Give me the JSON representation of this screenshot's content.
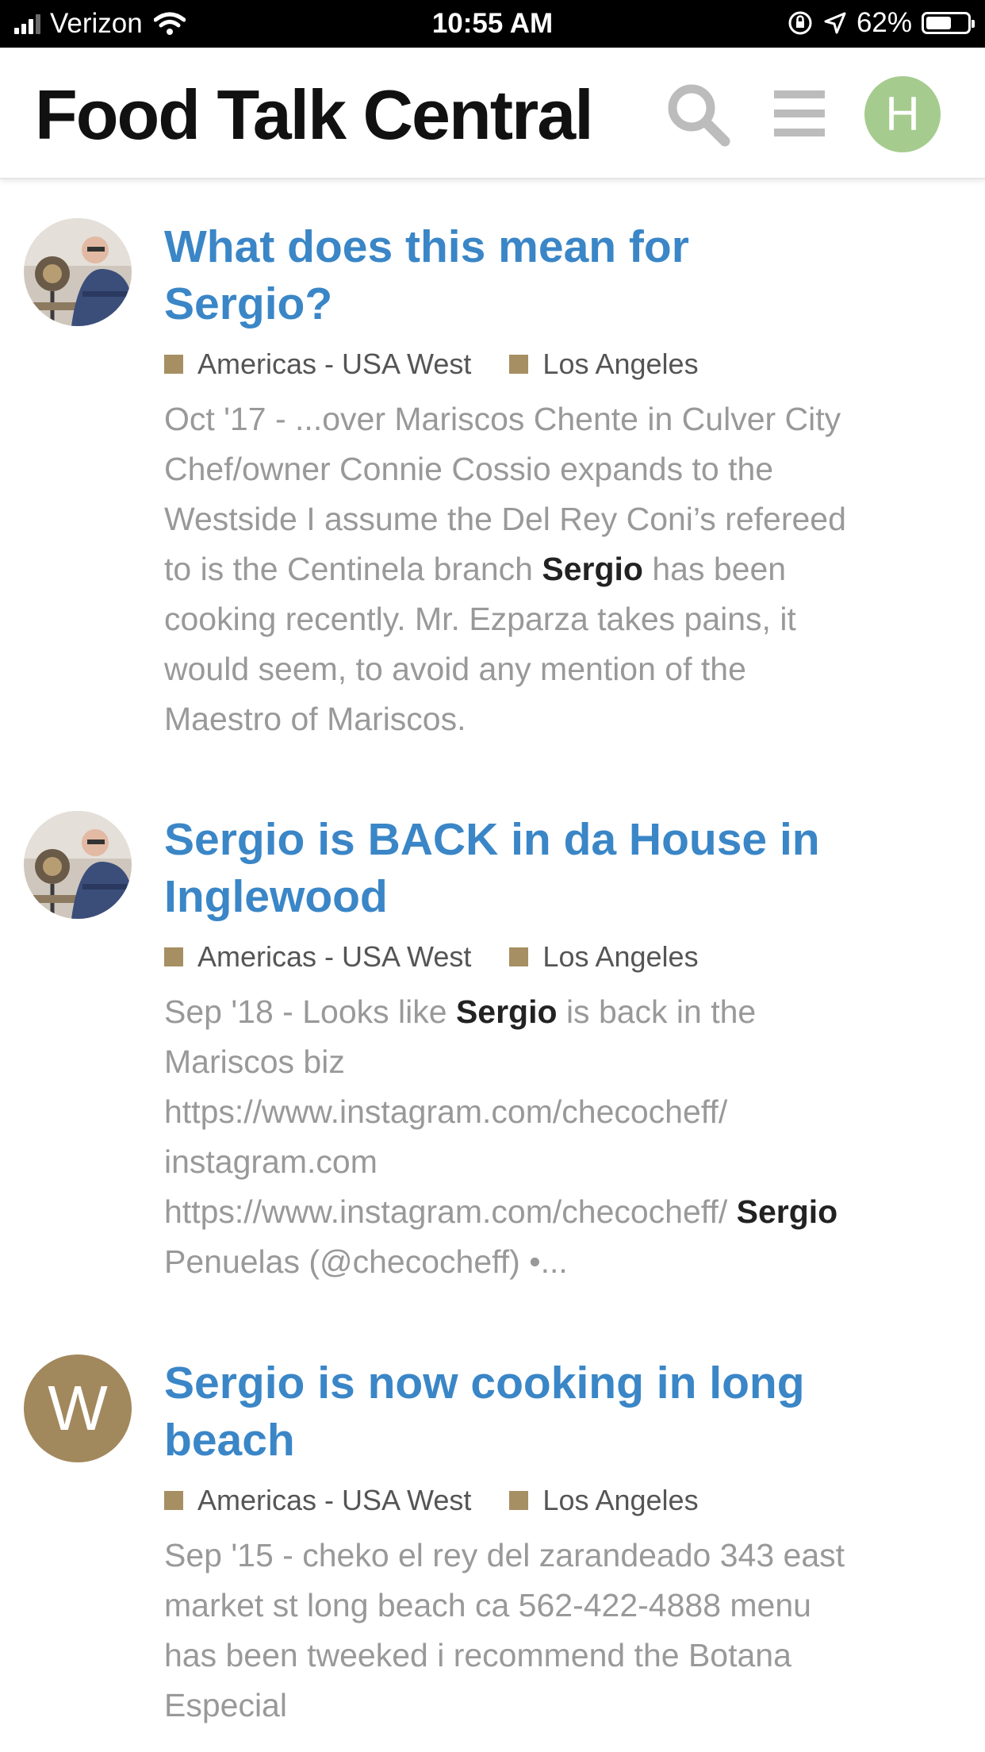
{
  "status_bar": {
    "carrier": "Verizon",
    "time": "10:55 AM",
    "battery": "62%",
    "battery_level": 0.62
  },
  "header": {
    "title": "Food Talk Central",
    "search_icon": "search-icon",
    "menu_icon": "hamburger-menu-icon",
    "user_initial": "H"
  },
  "results": [
    {
      "title_pre": "What does this mean for",
      "title_bold": "Sergio",
      "title_post": "?",
      "categories": [
        "Americas - USA West",
        "Los Angeles"
      ],
      "snippet_pre": "Oct '17 - ...over Mariscos Chente in Culver City Chef/owner Connie Cossio expands to the Westside I assume the Del Rey Coni’s refereed to is the Centinela branch",
      "snippet_bold": "Sergio",
      "snippet_post": "has been cooking recently. Mr. Ezparza takes pains, it would seem, to avoid any mention of the Maestro of Mariscos."
    },
    {
      "title_bold": "Sergio",
      "title_post": "is BACK in da House in Inglewood",
      "categories": [
        "Americas - USA West",
        "Los Angeles"
      ],
      "snippet_pre": "Sep '18 - Looks like",
      "snippet_bold": "Sergio",
      "snippet_mid": "is back in the Mariscos biz https://www.instagram.com/checocheff/ instagram.com https://www.instagram.com/checocheff/",
      "snippet_bold2": "Sergio",
      "snippet_post": "Penuelas (@checocheff) •..."
    },
    {
      "avatar_letter": "W",
      "title_bold": "Sergio",
      "title_post": "is now cooking in long beach",
      "categories": [
        "Americas - USA West",
        "Los Angeles"
      ],
      "snippet": "Sep '15 - cheko el rey del zarandeado 343 east market st long beach ca 562-422-4888 menu has been tweeked i recommend the Botana Especial"
    }
  ],
  "colors": {
    "link": "#3a86c7",
    "category_swatch": "#a68f62",
    "user_avatar": "#a5cc8e",
    "w_avatar": "#a2885d"
  }
}
